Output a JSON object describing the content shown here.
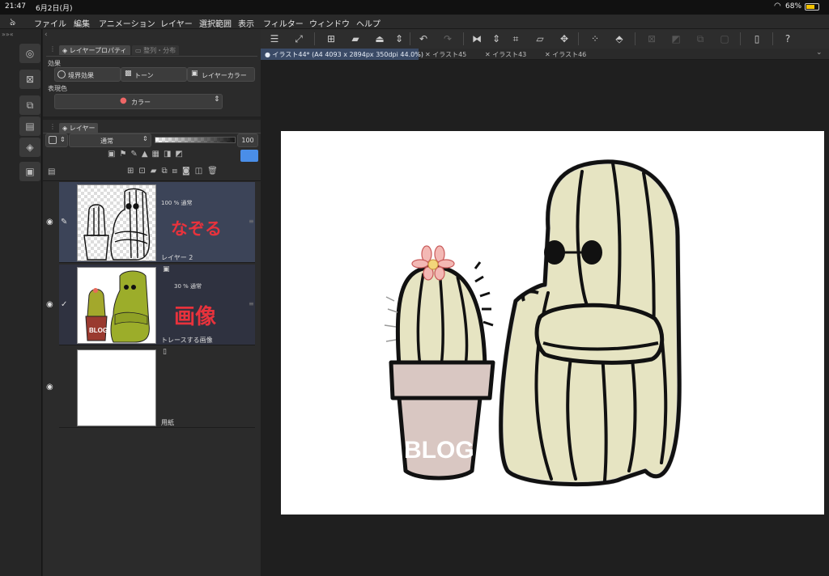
{
  "status": {
    "time": "21:47",
    "date": "6月2日(月)",
    "battery": "68%"
  },
  "menu": {
    "items": [
      "ファイル",
      "編集",
      "アニメーション",
      "レイヤー",
      "選択範囲",
      "表示",
      "フィルター",
      "ウィンドウ",
      "ヘルプ"
    ]
  },
  "panel": {
    "tab_layer_property": "レイヤープロパティ",
    "tab_other": "整列・分布",
    "effect_section": "効果",
    "effect_border": "境界効果",
    "effect_tone": "トーン",
    "effect_layer_color": "レイヤーカラー",
    "expression_color_section": "表現色",
    "expression_color_value": "カラー",
    "tab_layers": "レイヤー",
    "blend_mode": "通常",
    "opacity": "100"
  },
  "layers": [
    {
      "opacity_mode": "100 %  通常",
      "annotation": "なぞる",
      "name": "レイヤー 2",
      "selected": true
    },
    {
      "opacity_mode": "30 %  通常",
      "annotation": "画像",
      "name": "トレースする画像",
      "selected": false
    },
    {
      "opacity_mode": "",
      "annotation": "",
      "name": "用紙",
      "selected": false
    }
  ],
  "thumb_text": {
    "blog": "BLOG"
  },
  "doc_tabs": [
    {
      "label": "イラスト44* (A4 4093 x 2894px 350dpi 44.0%)",
      "active": true
    },
    {
      "label": "イラスト45",
      "active": false
    },
    {
      "label": "イラスト43",
      "active": false
    },
    {
      "label": "イラスト46",
      "active": false
    }
  ],
  "artwork": {
    "pot_text": "BLOG"
  },
  "colors": {
    "accent": "#4a8ee8",
    "selected_layer": "#3c4458",
    "annotation_red": "#e8323c",
    "cactus_fill": "#e6e4c2",
    "pot_fill": "#d9c7c2"
  }
}
